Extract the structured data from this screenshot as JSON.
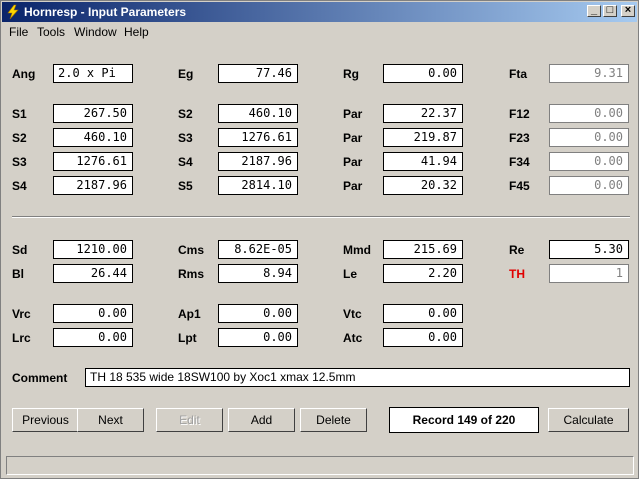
{
  "window": {
    "title": "Hornresp - Input Parameters"
  },
  "menu": [
    "File",
    "Tools",
    "Window",
    "Help"
  ],
  "fields": {
    "Ang": {
      "label": "Ang",
      "value": "2.0 x Pi"
    },
    "Eg": {
      "label": "Eg",
      "value": "77.46"
    },
    "Rg": {
      "label": "Rg",
      "value": "0.00"
    },
    "Fta": {
      "label": "Fta",
      "value": "9.31"
    },
    "S1": {
      "label": "S1",
      "value": "267.50"
    },
    "S2a": {
      "label": "S2",
      "value": "460.10"
    },
    "Par1": {
      "label": "Par",
      "value": "22.37"
    },
    "F12": {
      "label": "F12",
      "value": "0.00"
    },
    "S2b": {
      "label": "S2",
      "value": "460.10"
    },
    "S3a": {
      "label": "S3",
      "value": "1276.61"
    },
    "Par2": {
      "label": "Par",
      "value": "219.87"
    },
    "F23": {
      "label": "F23",
      "value": "0.00"
    },
    "S3b": {
      "label": "S3",
      "value": "1276.61"
    },
    "S4a": {
      "label": "S4",
      "value": "2187.96"
    },
    "Par3": {
      "label": "Par",
      "value": "41.94"
    },
    "F34": {
      "label": "F34",
      "value": "0.00"
    },
    "S4b": {
      "label": "S4",
      "value": "2187.96"
    },
    "S5": {
      "label": "S5",
      "value": "2814.10"
    },
    "Par4": {
      "label": "Par",
      "value": "20.32"
    },
    "F45": {
      "label": "F45",
      "value": "0.00"
    },
    "Sd": {
      "label": "Sd",
      "value": "1210.00"
    },
    "Cms": {
      "label": "Cms",
      "value": "8.62E-05"
    },
    "Mmd": {
      "label": "Mmd",
      "value": "215.69"
    },
    "Re": {
      "label": "Re",
      "value": "5.30"
    },
    "Bl": {
      "label": "Bl",
      "value": "26.44"
    },
    "Rms": {
      "label": "Rms",
      "value": "8.94"
    },
    "Le": {
      "label": "Le",
      "value": "2.20"
    },
    "TH": {
      "label": "TH",
      "value": "1"
    },
    "Vrc": {
      "label": "Vrc",
      "value": "0.00"
    },
    "Ap1": {
      "label": "Ap1",
      "value": "0.00"
    },
    "Vtc": {
      "label": "Vtc",
      "value": "0.00"
    },
    "Lrc": {
      "label": "Lrc",
      "value": "0.00"
    },
    "Lpt": {
      "label": "Lpt",
      "value": "0.00"
    },
    "Atc": {
      "label": "Atc",
      "value": "0.00"
    }
  },
  "comment": {
    "label": "Comment",
    "value": "TH 18 535 wide 18SW100 by Xoc1 xmax 12.5mm"
  },
  "buttons": {
    "previous": "Previous",
    "next": "Next",
    "edit": "Edit",
    "add": "Add",
    "delete": "Delete",
    "calculate": "Calculate"
  },
  "record": "Record 149 of 220",
  "colors": {
    "titlebar_start": "#0a246a",
    "titlebar_end": "#a6caf0",
    "th_label": "#e00000"
  }
}
